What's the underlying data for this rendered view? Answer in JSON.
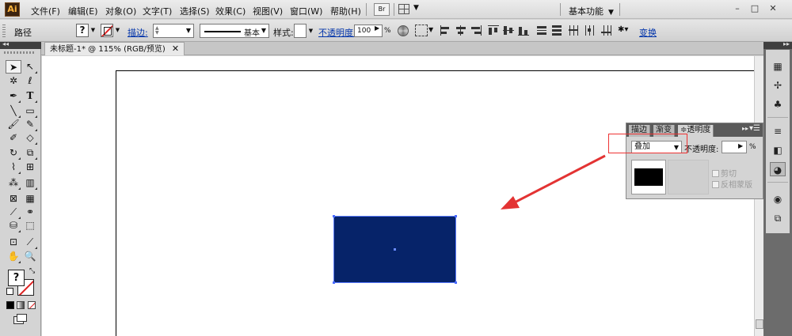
{
  "app": {
    "logo": "Ai"
  },
  "menubar": {
    "items": [
      "文件(F)",
      "编辑(E)",
      "对象(O)",
      "文字(T)",
      "选择(S)",
      "效果(C)",
      "视图(V)",
      "窗口(W)",
      "帮助(H)"
    ],
    "bridge_label": "Br",
    "workspace": "基本功能",
    "window_controls": [
      "–",
      "□",
      "✕"
    ]
  },
  "controlbar": {
    "selection_type": "路径",
    "fill_label": "?",
    "stroke_label": "描边:",
    "brush_label": "基本",
    "style_label": "样式:",
    "opacity_label": "不透明度:",
    "opacity_value": "100",
    "opacity_unit": "%",
    "transform_label": "变换"
  },
  "document": {
    "tab_title": "未标题-1* @ 115% (RGB/预览)",
    "close_glyph": "✕"
  },
  "tools": {
    "fill_label": "?"
  },
  "transparency_panel": {
    "tabs": [
      "描边",
      "渐变",
      "≑透明度"
    ],
    "blend_mode": "叠加",
    "opacity_label": "不透明度:",
    "opacity_unit": "%",
    "clip_label": "剪切",
    "invert_mask_label": "反相蒙版",
    "menu_glyph": "▸▸",
    "options_glyph": "▾☰"
  },
  "colors": {
    "shape_fill": "#062369",
    "selection": "#4a6bff",
    "annotation": "#e33333"
  },
  "icons": {
    "tools": [
      "selection-tool",
      "direct-selection-tool",
      "magic-wand-tool",
      "lasso-tool",
      "pen-tool",
      "type-tool",
      "line-tool",
      "rectangle-tool",
      "paintbrush-tool",
      "pencil-tool",
      "blob-brush-tool",
      "eraser-tool",
      "rotate-tool",
      "scale-tool",
      "warp-tool",
      "free-transform-tool",
      "symbol-sprayer-tool",
      "column-graph-tool",
      "mesh-tool",
      "gradient-tool",
      "eyedropper-tool",
      "blend-tool",
      "live-paint-bucket-tool",
      "live-paint-selection-tool",
      "artboard-tool",
      "slice-tool",
      "hand-tool",
      "zoom-tool"
    ],
    "dock": [
      "swatches",
      "brushes",
      "symbols",
      "stroke",
      "gradient",
      "transparency",
      "appearance",
      "layers"
    ]
  }
}
